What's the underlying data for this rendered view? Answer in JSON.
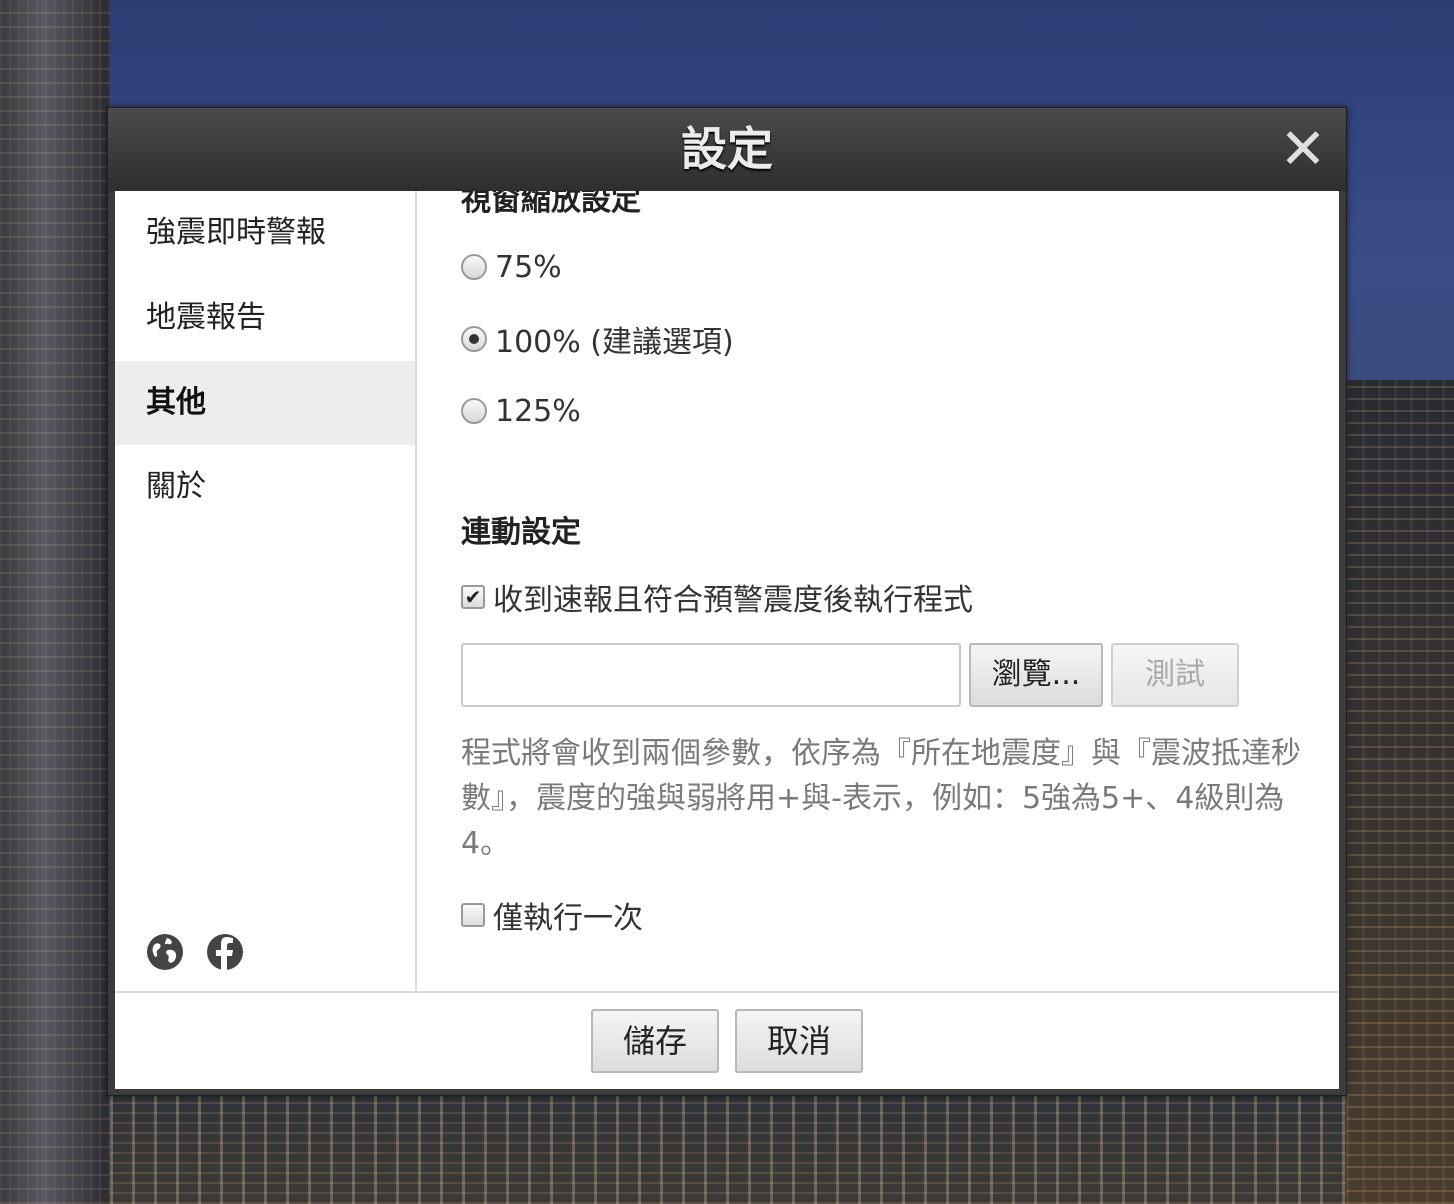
{
  "dialog": {
    "title": "設定",
    "close_symbol": "✕"
  },
  "sidebar": {
    "items": [
      {
        "label": "強震即時警報",
        "active": false
      },
      {
        "label": "地震報告",
        "active": false
      },
      {
        "label": "其他",
        "active": true
      },
      {
        "label": "關於",
        "active": false
      }
    ],
    "social_icons": [
      "globe-icon",
      "facebook-icon"
    ]
  },
  "content": {
    "zoom_section": {
      "title": "視窗縮放設定",
      "options": [
        "75%",
        "100% (建議選項)",
        "125%"
      ],
      "selected": "100% (建議選項)"
    },
    "link_section": {
      "title": "連動設定",
      "run_program_checkbox": {
        "label": "收到速報且符合預警震度後執行程式",
        "checked": true
      },
      "program_path": {
        "value": "",
        "placeholder": ""
      },
      "browse_button": "瀏覽...",
      "test_button": "測試",
      "hint": "程式將會收到兩個參數，依序為『所在地震度』與『震波抵達秒數』，震度的強與弱將用+與-表示，例如：5強為5+、4級則為4。",
      "run_once_checkbox": {
        "label": "僅執行一次",
        "checked": false
      }
    }
  },
  "footer": {
    "save_button": "儲存",
    "cancel_button": "取消"
  }
}
